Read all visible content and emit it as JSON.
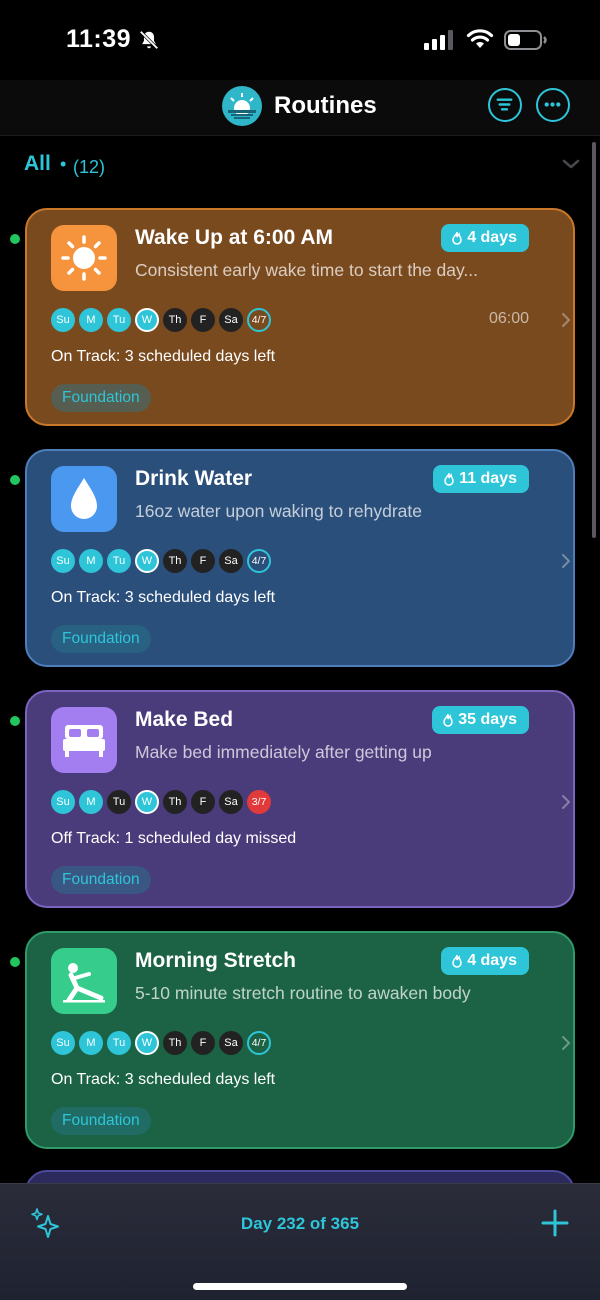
{
  "status_bar": {
    "time": "11:39"
  },
  "header": {
    "title": "Routines"
  },
  "filter": {
    "label": "All",
    "separator": "•",
    "count": "(12)"
  },
  "routines": [
    {
      "title": "Wake Up at 6:00 AM",
      "description": "Consistent early wake time to start the day...",
      "streak": "4 days",
      "days": [
        "Su",
        "M",
        "Tu",
        "W",
        "Th",
        "F",
        "Sa"
      ],
      "progress": "4/7",
      "time": "06:00",
      "status": "On Track: 3 scheduled days left",
      "category": "Foundation",
      "colors": {
        "bg": "#7a4a1f",
        "border": "#c9782a",
        "icon": "#f5943d"
      },
      "icon": "sun-icon"
    },
    {
      "title": "Drink Water",
      "description": "16oz water upon waking to rehydrate",
      "streak": "11 days",
      "days": [
        "Su",
        "M",
        "Tu",
        "W",
        "Th",
        "F",
        "Sa"
      ],
      "progress": "4/7",
      "time": "",
      "status": "On Track: 3 scheduled days left",
      "category": "Foundation",
      "colors": {
        "bg": "#2b4f7b",
        "border": "#4d7fbd",
        "icon": "#4a98f0"
      },
      "icon": "water-drop-icon"
    },
    {
      "title": "Make Bed",
      "description": "Make bed immediately after getting up",
      "streak": "35 days",
      "days": [
        "Su",
        "M",
        "Tu",
        "W",
        "Th",
        "F",
        "Sa"
      ],
      "progress": "3/7",
      "time": "",
      "status": "Off Track: 1 scheduled day missed",
      "category": "Foundation",
      "colors": {
        "bg": "#4a3b7a",
        "border": "#7b64c0",
        "icon": "#a27ef0"
      },
      "icon": "bed-icon"
    },
    {
      "title": "Morning Stretch",
      "description": "5-10 minute stretch routine to awaken body",
      "streak": "4 days",
      "days": [
        "Su",
        "M",
        "Tu",
        "W",
        "Th",
        "F",
        "Sa"
      ],
      "progress": "4/7",
      "time": "",
      "status": "On Track: 3 scheduled days left",
      "category": "Foundation",
      "colors": {
        "bg": "#1b6344",
        "border": "#2f9a6a",
        "icon": "#35cc8c"
      },
      "icon": "stretch-icon"
    }
  ],
  "footer": {
    "day_counter": "Day 232 of 365"
  }
}
